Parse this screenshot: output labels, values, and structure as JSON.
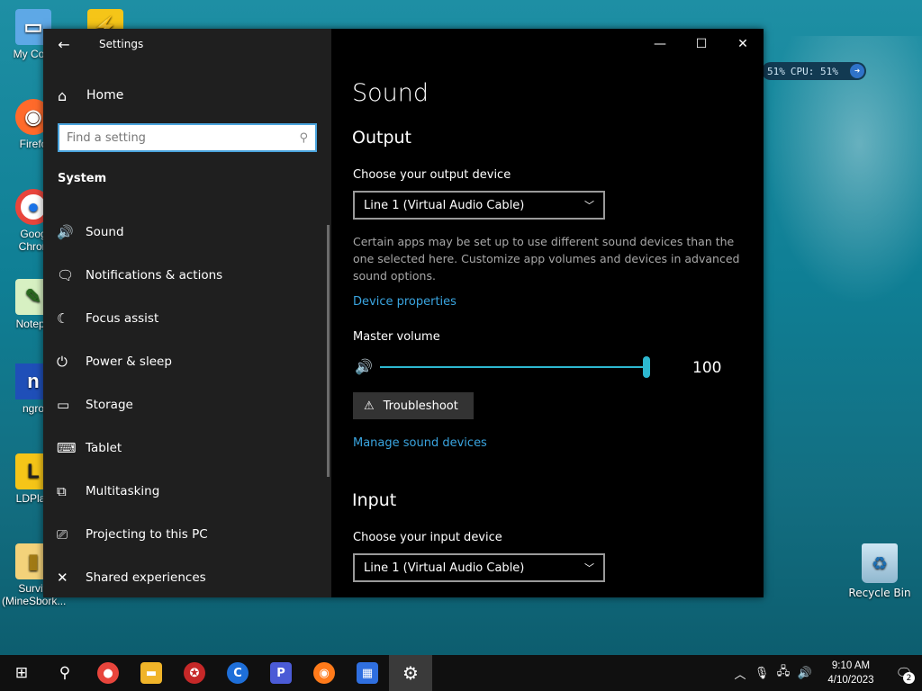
{
  "desktop": {
    "icons": [
      {
        "label": "My Com",
        "glyph": "▭"
      },
      {
        "label": "Firefo",
        "glyph": "◉"
      },
      {
        "label": "Goog",
        "label2": "Chron",
        "glyph": "●"
      },
      {
        "label": "Notepa",
        "glyph": "✎"
      },
      {
        "label": "ngro",
        "glyph": "n"
      },
      {
        "label": "LDPlay",
        "glyph": "L"
      },
      {
        "label": "Surviv",
        "label2": "(MineSbork...",
        "glyph": "▮"
      }
    ],
    "recycle_bin": {
      "label": "Recycle Bin",
      "glyph": "♻"
    },
    "perf_widget": {
      "ram": "51%",
      "cpu": "CPU: 51%"
    }
  },
  "window": {
    "title": "Settings",
    "nav": {
      "home_label": "Home",
      "search_placeholder": "Find a setting",
      "section_label": "System",
      "items": [
        {
          "label": "Sound",
          "icon": "🔊"
        },
        {
          "label": "Notifications & actions",
          "icon": "🗨"
        },
        {
          "label": "Focus assist",
          "icon": "☾"
        },
        {
          "label": "Power & sleep",
          "icon": "⏻"
        },
        {
          "label": "Storage",
          "icon": "▭"
        },
        {
          "label": "Tablet",
          "icon": "⌨"
        },
        {
          "label": "Multitasking",
          "icon": "⧉"
        },
        {
          "label": "Projecting to this PC",
          "icon": "⎚"
        },
        {
          "label": "Shared experiences",
          "icon": "✕"
        }
      ]
    },
    "content": {
      "page_title": "Sound",
      "output": {
        "heading": "Output",
        "device_label": "Choose your output device",
        "device_value": "Line 1 (Virtual Audio Cable)",
        "description": "Certain apps may be set up to use different sound devices than the one selected here. Customize app volumes and devices in advanced sound options.",
        "device_properties_link": "Device properties",
        "master_volume_label": "Master volume",
        "volume_value": "100",
        "volume_level": 1.0,
        "troubleshoot_label": "Troubleshoot",
        "manage_link": "Manage sound devices"
      },
      "input": {
        "heading": "Input",
        "device_label": "Choose your input device",
        "device_value": "Line 1 (Virtual Audio Cable)"
      }
    }
  },
  "taskbar": {
    "clock_time": "9:10 AM",
    "clock_date": "4/10/2023",
    "notification_count": "2",
    "apps": [
      {
        "name": "chrome",
        "color": "#e8453c"
      },
      {
        "name": "file-explorer",
        "color": "#f0b429"
      },
      {
        "name": "red-app",
        "color": "#c62828"
      },
      {
        "name": "ccleaner",
        "color": "#1e6fd9"
      },
      {
        "name": "pcloud",
        "color": "#4b5bd6"
      },
      {
        "name": "firefox",
        "color": "#ff7a1a"
      },
      {
        "name": "calculator",
        "color": "#2f6fe0"
      },
      {
        "name": "settings",
        "color": "#ffffff"
      }
    ]
  }
}
